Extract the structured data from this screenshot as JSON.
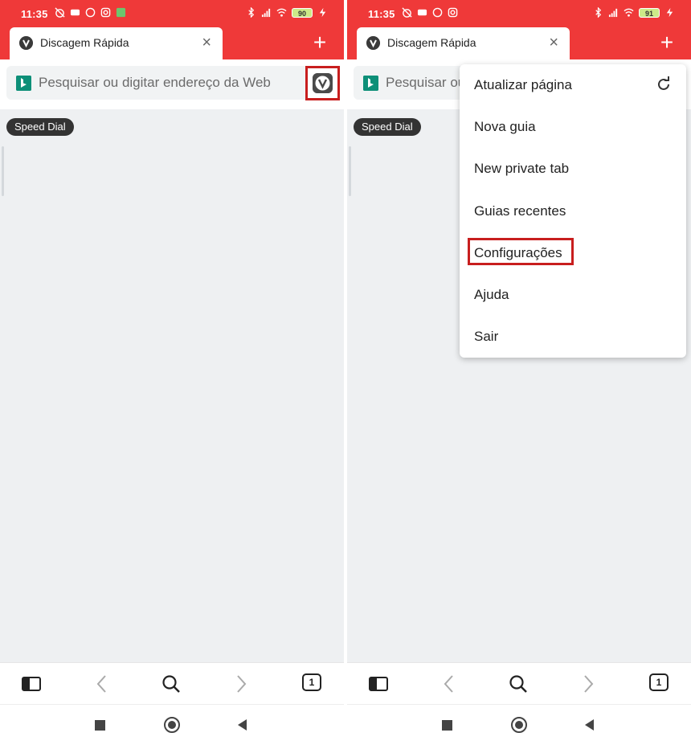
{
  "status_bar": {
    "time": "11:35",
    "battery_left": "90",
    "battery_right": "91",
    "status_color": "#ef3939"
  },
  "tab": {
    "title": "Discagem Rápida",
    "close_glyph": "×",
    "new_tab_glyph": "+"
  },
  "address_bar": {
    "placeholder_left": "Pesquisar ou digitar endereço da Web",
    "placeholder_right": "Pesquisar ou digitar endereço da Web",
    "search_engine_icon": "bing-icon",
    "menu_button_icon": "vivaldi-icon"
  },
  "speed_dial": {
    "label": "Speed Dial"
  },
  "menu": {
    "items": [
      {
        "label": "Atualizar página",
        "icon": "refresh-icon"
      },
      {
        "label": "Nova guia"
      },
      {
        "label": "New private tab"
      },
      {
        "label": "Guias recentes"
      },
      {
        "label": "Configurações",
        "highlighted": true
      },
      {
        "label": "Ajuda"
      },
      {
        "label": "Sair"
      }
    ]
  },
  "toolbar": {
    "tab_count": "1",
    "icons": [
      "panel-icon",
      "back-icon",
      "search-icon",
      "forward-icon",
      "tab-switcher-icon"
    ]
  },
  "system_nav": {
    "icons": [
      "recents-icon",
      "home-icon",
      "back-icon"
    ]
  },
  "colors": {
    "brand_red": "#ef3939",
    "highlight_red": "#c81e1e",
    "bing_teal": "#0d8f78"
  }
}
